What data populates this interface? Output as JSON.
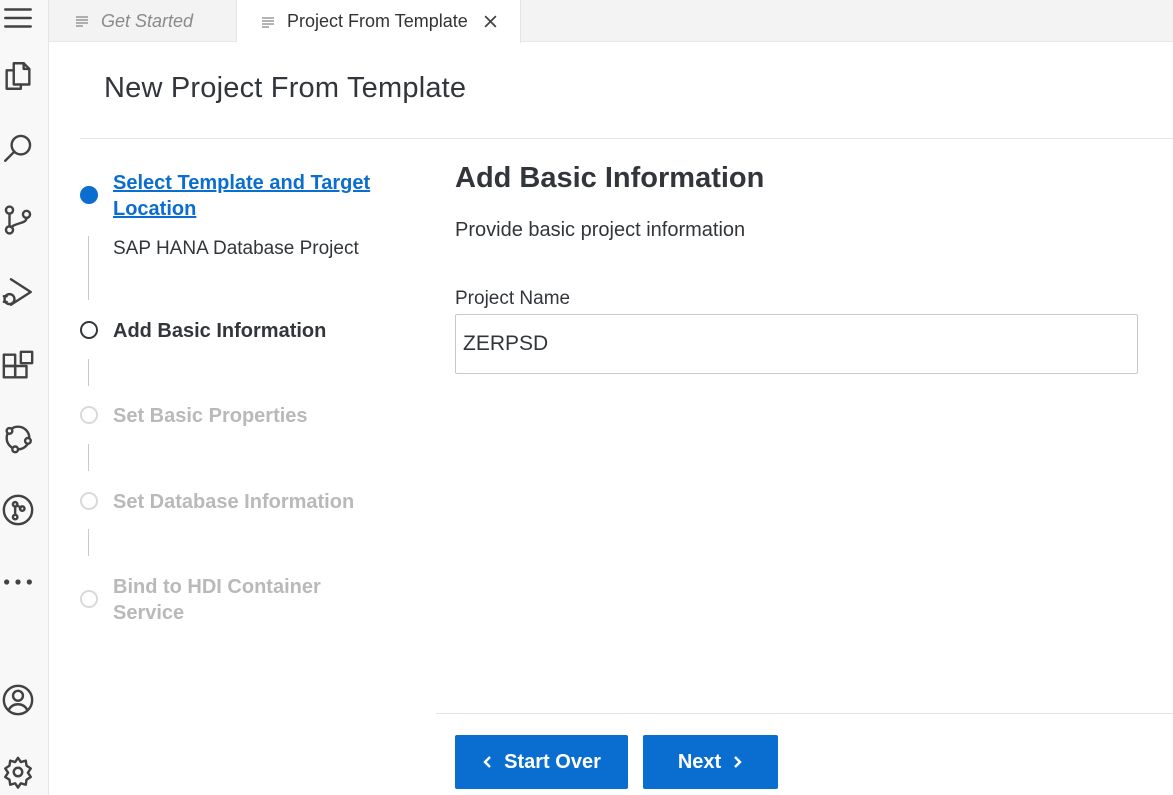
{
  "tabs": [
    {
      "label": "Get Started"
    },
    {
      "label": "Project From Template"
    }
  ],
  "page": {
    "title": "New Project From Template"
  },
  "steps": [
    {
      "label": "Select Template and Target Location",
      "label_line1": "Select Template and Target",
      "label_line2": "Location",
      "sub": "SAP HANA Database Project",
      "state": "completed"
    },
    {
      "label": "Add Basic Information",
      "state": "current"
    },
    {
      "label": "Set Basic Properties",
      "state": "upcoming"
    },
    {
      "label": "Set Database Information",
      "state": "upcoming"
    },
    {
      "label": "Bind to HDI Container Service",
      "label_line1": "Bind to HDI Container",
      "label_line2": "Service",
      "state": "upcoming"
    }
  ],
  "form": {
    "title": "Add Basic Information",
    "description": "Provide basic project information",
    "project_name_label": "Project Name",
    "project_name_value": "ZERPSD"
  },
  "buttons": {
    "start_over": "Start Over",
    "next": "Next"
  },
  "activity_bar": [
    "menu-icon",
    "explorer-icon",
    "search-icon",
    "source-control-icon",
    "run-debug-icon",
    "extensions-icon",
    "cloud-foundry-icon",
    "git-graph-icon",
    "more-icon",
    "account-icon",
    "settings-icon"
  ],
  "colors": {
    "accent": "#0a6ed1",
    "upcoming_step": "#b9b9b9",
    "text": "#32363a"
  }
}
